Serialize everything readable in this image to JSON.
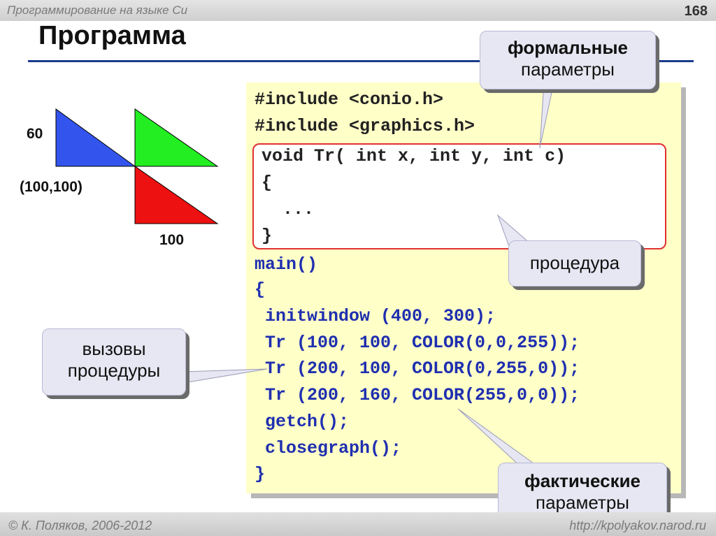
{
  "header": {
    "course": "Программирование на языке Си",
    "slide_number": "168"
  },
  "title": "Программа",
  "diagram": {
    "label_height": "60",
    "label_origin": "(100,100)",
    "label_width": "100",
    "colors": {
      "blue": "#3355ee",
      "green": "#22ee22",
      "red": "#ee1111"
    }
  },
  "code": {
    "lines": [
      "#include <conio.h>",
      "#include <graphics.h>",
      "void Tr( int x, int y, int c)",
      "{",
      "  ...",
      "}",
      "main()",
      "{",
      " initwindow (400, 300);",
      " Tr (100, 100, COLOR(0,0,255));",
      " Tr (200, 100, COLOR(0,255,0));",
      " Tr (200, 160, COLOR(255,0,0));",
      " getch();",
      " closegraph();",
      "}"
    ]
  },
  "callouts": {
    "formal": {
      "line1": "формальные",
      "line2": "параметры"
    },
    "procedure": {
      "text": "процедура"
    },
    "calls": {
      "line1": "вызовы",
      "line2": "процедуры"
    },
    "actual": {
      "line1": "фактические",
      "line2": "параметры"
    }
  },
  "footer": {
    "author": "© К. Поляков, 2006-2012",
    "site": "http://kpolyakov.narod.ru"
  }
}
